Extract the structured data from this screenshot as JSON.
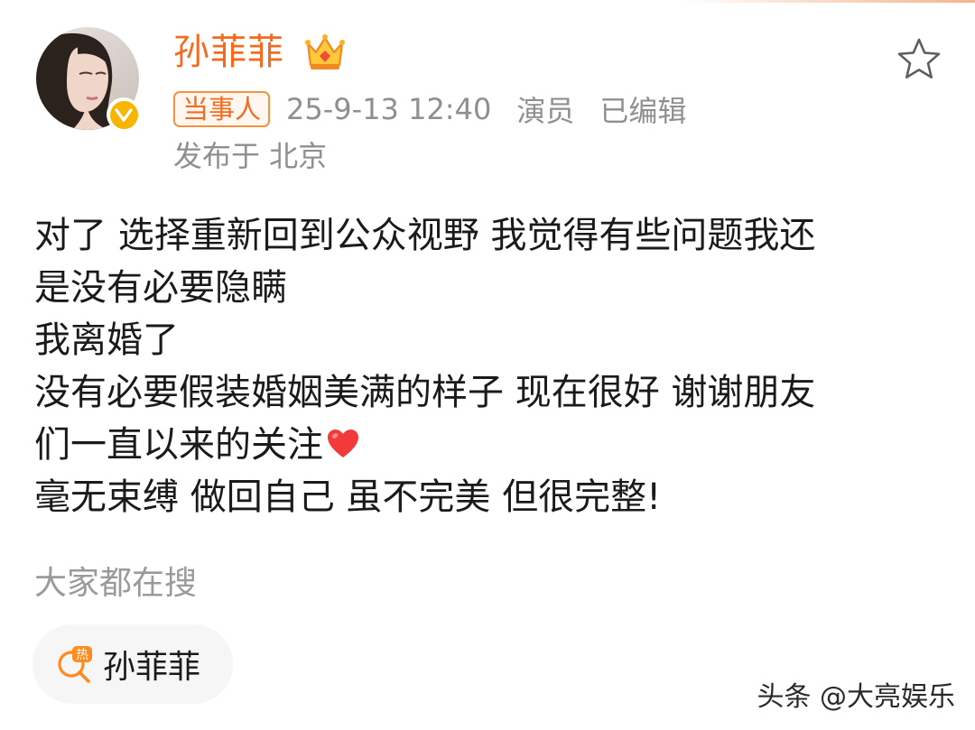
{
  "post": {
    "author": {
      "name": "孙菲菲",
      "verified_color": "#f7b500",
      "name_color": "#f46b1f",
      "crown_icon": "crown-icon"
    },
    "meta": {
      "role_tag": "当事人",
      "datetime": "25-9-13 12:40",
      "profession": "演员",
      "edited": "已编辑",
      "location": "发布于 北京"
    },
    "content_lines": [
      "对了 选择重新回到公众视野 我觉得有些问题我还",
      "是没有必要隐瞒",
      "我离婚了",
      "没有必要假装婚姻美满的样子 现在很好 谢谢朋友",
      "们一直以来的关注",
      "毫无束缚 做回自己 虽不完美 但很完整!"
    ],
    "heart_icon": "red-heart-icon"
  },
  "search": {
    "title": "大家都在搜",
    "hot_item_label": "孙菲菲",
    "hot_icon": "hot-search-icon"
  },
  "watermark": "头条 @大亮娱乐",
  "colors": {
    "accent": "#f46b1f",
    "meta_text": "#8f8f8f",
    "chip_bg": "#f6f6f6"
  }
}
